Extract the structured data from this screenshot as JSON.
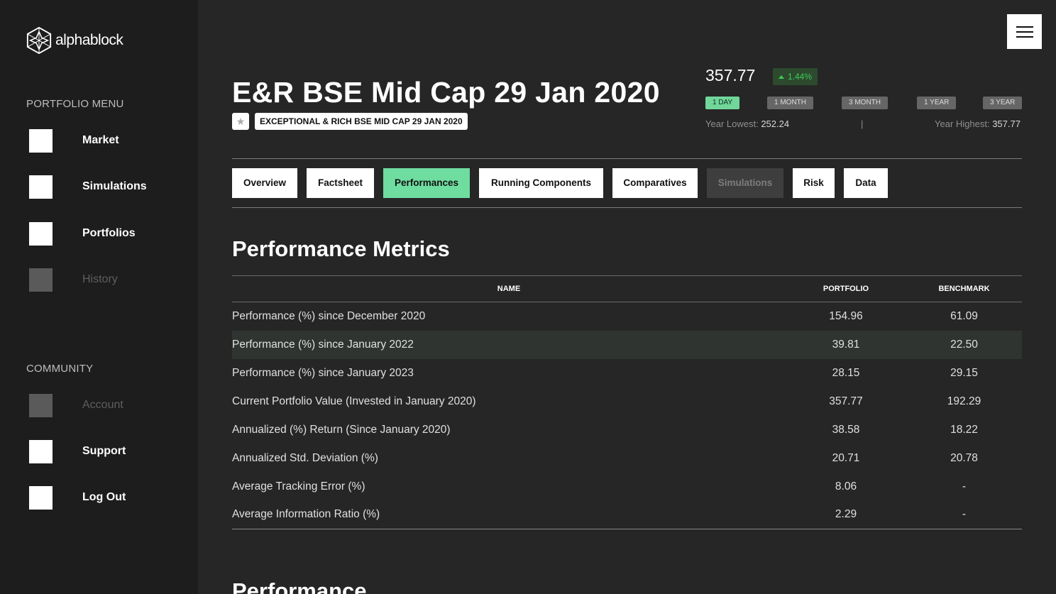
{
  "brand": {
    "name": "alphablock"
  },
  "sidebar": {
    "portfolio_menu_title": "PORTFOLIO MENU",
    "portfolio_items": [
      {
        "label": "Market",
        "enabled": true
      },
      {
        "label": "Simulations",
        "enabled": true
      },
      {
        "label": "Portfolios",
        "enabled": true
      },
      {
        "label": "History",
        "enabled": false
      }
    ],
    "community_title": "COMMUNITY",
    "community_items": [
      {
        "label": "Account",
        "enabled": false
      },
      {
        "label": "Support",
        "enabled": true
      },
      {
        "label": "Log Out",
        "enabled": true
      }
    ]
  },
  "header": {
    "title": "E&R BSE Mid Cap 29 Jan 2020",
    "subtitle_tag": "EXCEPTIONAL & RICH BSE MID CAP 29 JAN 2020",
    "price": "357.77",
    "change": "1.44%",
    "change_direction": "up",
    "ranges": [
      "1 DAY",
      "1 MONTH",
      "3 MONTH",
      "1 YEAR",
      "3 YEAR"
    ],
    "active_range": "1 DAY",
    "year_lowest_label": "Year Lowest:",
    "year_lowest_value": "252.24",
    "separator": "|",
    "year_highest_label": "Year Highest:",
    "year_highest_value": "357.77"
  },
  "tabs": [
    {
      "label": "Overview",
      "state": "normal"
    },
    {
      "label": "Factsheet",
      "state": "normal"
    },
    {
      "label": "Performances",
      "state": "active"
    },
    {
      "label": "Running Components",
      "state": "normal"
    },
    {
      "label": "Comparatives",
      "state": "normal"
    },
    {
      "label": "Simulations",
      "state": "disabled"
    },
    {
      "label": "Risk",
      "state": "normal"
    },
    {
      "label": "Data",
      "state": "normal"
    }
  ],
  "metrics": {
    "title": "Performance Metrics",
    "columns": [
      "NAME",
      "PORTFOLIO",
      "BENCHMARK"
    ],
    "rows": [
      {
        "name": "Performance (%) since December 2020",
        "portfolio": "154.96",
        "benchmark": "61.09"
      },
      {
        "name": "Performance (%) since January 2022",
        "portfolio": "39.81",
        "benchmark": "22.50"
      },
      {
        "name": "Performance (%) since January 2023",
        "portfolio": "28.15",
        "benchmark": "29.15"
      },
      {
        "name": "Current Portfolio Value (Invested in January 2020)",
        "portfolio": "357.77",
        "benchmark": "192.29"
      },
      {
        "name": "Annualized (%) Return (Since January 2020)",
        "portfolio": "38.58",
        "benchmark": "18.22"
      },
      {
        "name": "Annualized Std. Deviation (%)",
        "portfolio": "20.71",
        "benchmark": "20.78"
      },
      {
        "name": "Average Tracking Error (%)",
        "portfolio": "8.06",
        "benchmark": "-"
      },
      {
        "name": "Average Information Ratio (%)",
        "portfolio": "2.29",
        "benchmark": "-"
      }
    ],
    "highlighted_row": 1
  },
  "next_section": {
    "title": "Performance"
  },
  "colors": {
    "background": "#262626",
    "sidebar": "#1d1d1d",
    "accent_green": "#6fdca0",
    "positive": "#3bcc55"
  },
  "icons": {
    "logo": "hexagon-star-icon",
    "menu": "hamburger-icon",
    "favorite": "star-icon",
    "change": "triangle-up-icon"
  }
}
